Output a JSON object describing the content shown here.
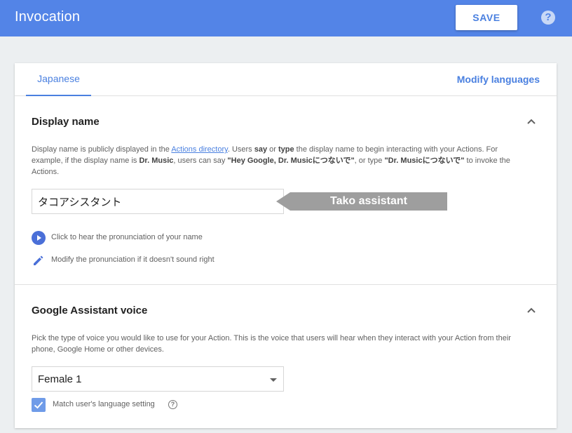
{
  "header": {
    "title": "Invocation",
    "save_label": "SAVE",
    "help_glyph": "?"
  },
  "tabs": {
    "active": "Japanese",
    "modify_languages": "Modify languages"
  },
  "display_name": {
    "title": "Display name",
    "desc_part1": "Display name is publicly displayed in the ",
    "desc_link": "Actions directory",
    "desc_part2": ". Users ",
    "say": "say",
    "or": " or ",
    "type": "type",
    "desc_part3": " the display name to begin interacting with your Actions. For example, if the display name is ",
    "dr_music": "Dr. Music",
    "desc_part4": ", users can say ",
    "example1": "\"Hey Google, Dr. Musicにつないで\"",
    "desc_part5": ", or type ",
    "example2": "\"Dr. Musicにつないで\"",
    "desc_part6": " to invoke the Actions.",
    "value": "タコアシスタント",
    "callout": "Tako assistant",
    "play_label": "Click to hear the pronunciation of your name",
    "edit_label": "Modify the pronunciation if it doesn't sound right"
  },
  "voice": {
    "title": "Google Assistant voice",
    "desc": "Pick the type of voice you would like to use for your Action. This is the voice that users will hear when they interact with your Action from their phone, Google Home or other devices.",
    "selected": "Female 1",
    "match_label": "Match user's language setting",
    "match_checked": true,
    "info_glyph": "?"
  },
  "colors": {
    "header": "#5384e7",
    "accent": "#4a80e0",
    "callout": "#9e9e9e"
  },
  "icons": {
    "help": "help-circle-icon",
    "chevron": "chevron-up-icon",
    "play": "play-circle-icon",
    "edit": "pencil-icon",
    "dropdown": "dropdown-arrow-icon",
    "check": "checkmark-icon",
    "info": "info-circle-icon"
  }
}
